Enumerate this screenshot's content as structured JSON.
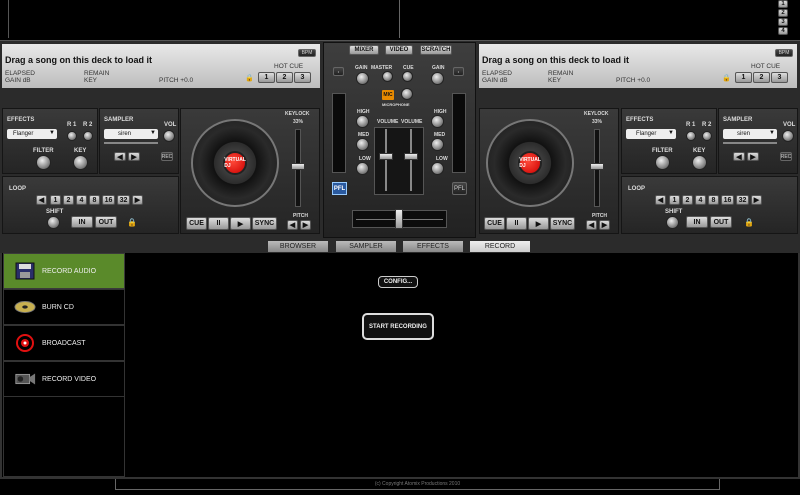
{
  "top": {
    "mini_buttons": [
      "1",
      "2",
      "3",
      "4"
    ]
  },
  "mixer": {
    "tabs": [
      "MIXER",
      "VIDEO",
      "SCRATCH"
    ],
    "labels": {
      "gain": "GAIN",
      "master": "MASTER",
      "cue": "CUE",
      "mic": "MIC",
      "microphone": "MICROPHONE",
      "high": "HIGH",
      "med": "MED",
      "low": "LOW",
      "volume": "VOLUME"
    },
    "pfl": "PFL"
  },
  "decks": [
    {
      "title": "Drag a song on this deck to load it",
      "bpm": "BPM",
      "elapsed": "ELAPSED",
      "remain": "REMAIN",
      "gain_db": "GAIN dB",
      "key": "KEY",
      "pitch": "PITCH +0.0",
      "hot_cue": "HOT CUE",
      "hot_cue_buttons": [
        "1",
        "2",
        "3"
      ],
      "effects": "EFFECTS",
      "effect_value": "Flanger",
      "r1": "R 1",
      "r2": "R 2",
      "filter": "FILTER",
      "key_lbl": "KEY",
      "sampler": "SAMPLER",
      "sampler_value": "siren",
      "vol": "VOL",
      "rec": "REC",
      "loop": "LOOP",
      "loop_buttons": [
        "1",
        "2",
        "4",
        "8",
        "16",
        "32"
      ],
      "shift": "SHIFT",
      "in": "IN",
      "out": "OUT",
      "keylock": "KEYLOCK",
      "pitch_pct": "33%",
      "pitch_lbl": "PITCH",
      "transport": [
        "CUE",
        "II",
        "▶",
        "SYNC"
      ],
      "label": "VIRTUAL DJ"
    },
    {
      "title": "Drag a song on this deck to load it",
      "bpm": "BPM",
      "elapsed": "ELAPSED",
      "remain": "REMAIN",
      "gain_db": "GAIN dB",
      "key": "KEY",
      "pitch": "PITCH +0.0",
      "hot_cue": "HOT CUE",
      "hot_cue_buttons": [
        "1",
        "2",
        "3"
      ],
      "effects": "EFFECTS",
      "effect_value": "Flanger",
      "r1": "R 1",
      "r2": "R 2",
      "filter": "FILTER",
      "key_lbl": "KEY",
      "sampler": "SAMPLER",
      "sampler_value": "siren",
      "vol": "VOL",
      "rec": "REC",
      "loop": "LOOP",
      "loop_buttons": [
        "1",
        "2",
        "4",
        "8",
        "16",
        "32"
      ],
      "shift": "SHIFT",
      "in": "IN",
      "out": "OUT",
      "keylock": "KEYLOCK",
      "pitch_pct": "33%",
      "pitch_lbl": "PITCH",
      "transport": [
        "CUE",
        "II",
        "▶",
        "SYNC"
      ],
      "label": "VIRTUAL DJ"
    }
  ],
  "tabs": [
    "BROWSER",
    "SAMPLER",
    "EFFECTS",
    "RECORD"
  ],
  "active_tab": "RECORD",
  "sidebar": [
    {
      "label": "RECORD AUDIO",
      "icon": "floppy-icon",
      "active": true
    },
    {
      "label": "BURN CD",
      "icon": "cd-icon",
      "active": false
    },
    {
      "label": "BROADCAST",
      "icon": "broadcast-icon",
      "active": false
    },
    {
      "label": "RECORD VIDEO",
      "icon": "camera-icon",
      "active": false
    }
  ],
  "record": {
    "config": "CONFIG...",
    "start": "START RECORDING"
  },
  "footer": {
    "copyright": "(c) Copyright Atomix Productions 2010"
  },
  "colors": {
    "accent_green": "#5a8a2a",
    "red": "#e01010",
    "blue": "#2a5aa0"
  }
}
